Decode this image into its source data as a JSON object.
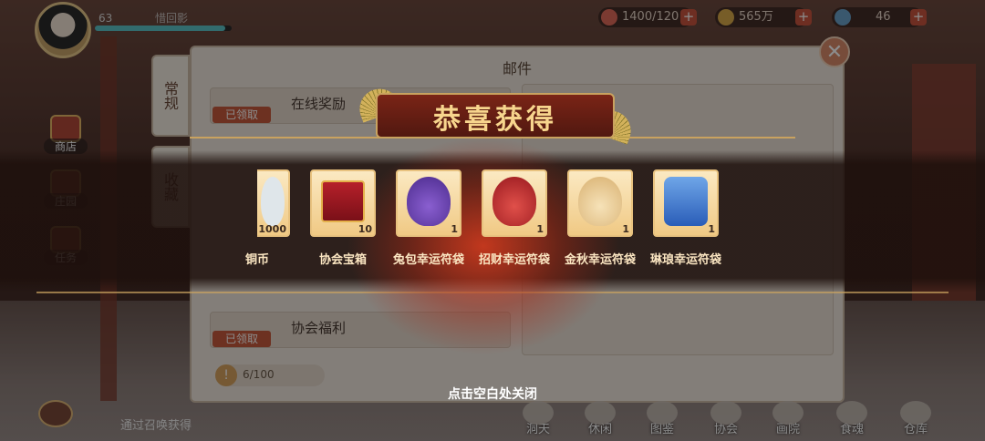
{
  "player": {
    "level": "63",
    "name": "惜回影",
    "exp_fraction": 0.95
  },
  "resources": [
    {
      "name": "stamina-icon",
      "value": "1400/120"
    },
    {
      "name": "coin-icon",
      "value": "565万"
    },
    {
      "name": "gem-icon",
      "value": "46"
    }
  ],
  "side_menu": [
    {
      "label": "商店"
    },
    {
      "label": "庄园"
    },
    {
      "label": "任务"
    }
  ],
  "mail": {
    "title": "邮件",
    "tabs": [
      {
        "label": "常规"
      },
      {
        "label": "收藏"
      }
    ],
    "items": [
      {
        "tag": "已领取",
        "text": "在线奖励"
      },
      {
        "tag": "已领取",
        "text": "协会福利"
      }
    ],
    "count": "6/100"
  },
  "reward_popup": {
    "title": "恭喜获得",
    "close_hint": "点击空白处关闭",
    "items": [
      {
        "name": "铜币",
        "count": "1000",
        "icon": "coin-pile-icon"
      },
      {
        "name": "协会宝箱",
        "count": "10",
        "icon": "treasure-chest-icon"
      },
      {
        "name": "兔包幸运符袋",
        "count": "1",
        "icon": "purple-pouch-icon"
      },
      {
        "name": "招财幸运符袋",
        "count": "1",
        "icon": "red-pouch-icon"
      },
      {
        "name": "金秋幸运符袋",
        "count": "1",
        "icon": "gold-pouch-icon"
      },
      {
        "name": "琳琅幸运符袋",
        "count": "1",
        "icon": "blue-charm-icon"
      }
    ]
  },
  "bottom_nav": [
    {
      "label": "洞天"
    },
    {
      "label": "休闲"
    },
    {
      "label": "图鉴"
    },
    {
      "label": "协会"
    },
    {
      "label": "画院"
    },
    {
      "label": "食魂"
    },
    {
      "label": "仓库"
    }
  ],
  "chat": {
    "message": "通过召唤获得"
  },
  "colors": {
    "accent_gold": "#f7d58d",
    "tag_red": "#c65a3c",
    "glow_red": "#dc3c1e"
  }
}
